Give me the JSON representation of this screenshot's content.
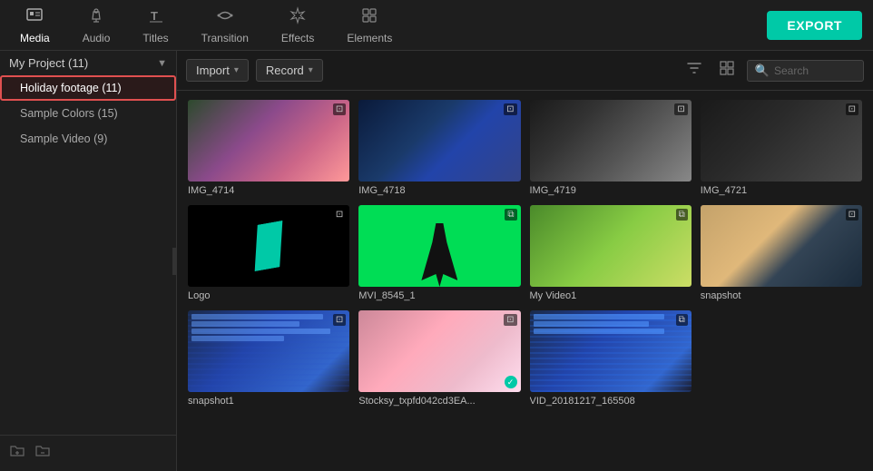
{
  "toolbar": {
    "items": [
      {
        "id": "media",
        "label": "Media",
        "icon": "🖼",
        "active": true
      },
      {
        "id": "audio",
        "label": "Audio",
        "icon": "♪",
        "active": false
      },
      {
        "id": "titles",
        "label": "Titles",
        "icon": "T",
        "active": false
      },
      {
        "id": "transition",
        "label": "Transition",
        "icon": "⇄",
        "active": false
      },
      {
        "id": "effects",
        "label": "Effects",
        "icon": "✦",
        "active": false
      },
      {
        "id": "elements",
        "label": "Elements",
        "icon": "⊞",
        "active": false
      }
    ],
    "export_label": "EXPORT"
  },
  "sidebar": {
    "project": {
      "label": "My Project (11)",
      "items": [
        {
          "id": "holiday",
          "label": "Holiday footage (11)",
          "selected": true
        },
        {
          "id": "colors",
          "label": "Sample Colors (15)",
          "selected": false
        },
        {
          "id": "videos",
          "label": "Sample Video (9)",
          "selected": false
        }
      ]
    },
    "footer_icons": [
      "folder-add",
      "folder-remove"
    ]
  },
  "content_toolbar": {
    "import_label": "Import",
    "record_label": "Record",
    "search_placeholder": "Search"
  },
  "media_items": [
    {
      "id": "img4714",
      "label": "IMG_4714",
      "type": "photo",
      "has_check": false,
      "thumb": "img4714"
    },
    {
      "id": "img4718",
      "label": "IMG_4718",
      "type": "photo",
      "has_check": false,
      "thumb": "img4718"
    },
    {
      "id": "img4719",
      "label": "IMG_4719",
      "type": "photo",
      "has_check": false,
      "thumb": "img4719"
    },
    {
      "id": "img4721",
      "label": "IMG_4721",
      "type": "photo",
      "has_check": false,
      "thumb": "img4721"
    },
    {
      "id": "logo",
      "label": "Logo",
      "type": "photo",
      "has_check": false,
      "thumb": "logo"
    },
    {
      "id": "mvi8545",
      "label": "MVI_8545_1",
      "type": "video",
      "has_check": false,
      "thumb": "mvi"
    },
    {
      "id": "myvideo1",
      "label": "My Video1",
      "type": "video",
      "has_check": false,
      "thumb": "myvideo"
    },
    {
      "id": "snapshot",
      "label": "snapshot",
      "type": "photo",
      "has_check": false,
      "thumb": "snapshot"
    },
    {
      "id": "snapshot1",
      "label": "snapshot1",
      "type": "photo",
      "has_check": false,
      "thumb": "snapshot1"
    },
    {
      "id": "stocksy",
      "label": "Stocksy_txpfd042cd3EA...",
      "type": "photo",
      "has_check": true,
      "thumb": "stocksy"
    },
    {
      "id": "vid20181217",
      "label": "VID_20181217_165508",
      "type": "video",
      "has_check": false,
      "thumb": "vid"
    }
  ]
}
